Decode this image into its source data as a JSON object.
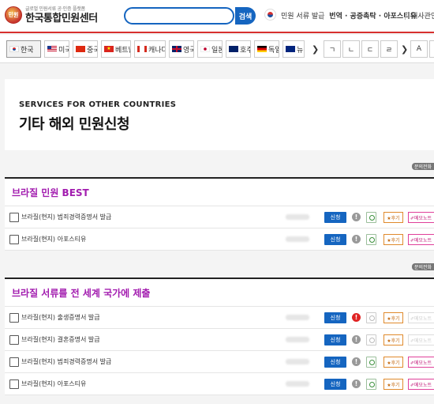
{
  "header": {
    "logo_sub": "글로벌 민원서류 공·인증 플랫폼",
    "logo_main": "한국통합민원센터",
    "logo_seal": "민원",
    "search_placeholder": "",
    "search_button": "검색",
    "nav": [
      "민원 서류 발급",
      "번역 · 공증촉탁 · 아포스티유",
      "대사관인"
    ]
  },
  "country_tabs": [
    "한국",
    "미국",
    "중국",
    "베트남",
    "캐나다",
    "영국",
    "일본",
    "호주",
    "독일",
    "뉴질"
  ],
  "prev_arrow": "❯",
  "next_arrow": "❯",
  "index_tabs": [
    "ㄱ",
    "ㄴ",
    "ㄷ",
    "ㄹ",
    "A",
    "B"
  ],
  "banner": {
    "english": "SERVICES FOR OTHER COUNTRIES",
    "korean": "기타 해외 민원신청"
  },
  "inquiry_label": "문의전화",
  "sections": [
    {
      "title": "브라질 민원 BEST",
      "rows": [
        {
          "name": "브라질(현지) 범죄경력증명서 발급",
          "apply": "신청",
          "review": "★후기",
          "memo": "✐메모노트"
        },
        {
          "name": "브라질(현지) 아포스티유",
          "apply": "신청",
          "review": "★후기",
          "memo": "✐메모노트"
        }
      ]
    },
    {
      "title": "브라질 서류를 전 세계 국가에 제출",
      "rows": [
        {
          "name": "브라질(현지) 출생증명서 발급",
          "apply": "신청",
          "review": "★후기",
          "memo": "✐메모노트"
        },
        {
          "name": "브라질(현지) 결혼증명서 발급",
          "apply": "신청",
          "review": "★후기",
          "memo": "✐메모노트"
        },
        {
          "name": "브라질(현지) 범죄경력증명서 발급",
          "apply": "신청",
          "review": "★후기",
          "memo": "✐메모노트"
        },
        {
          "name": "브라질(현지) 아포스티유",
          "apply": "신청",
          "review": "★후기",
          "memo": "✐메모노트"
        }
      ]
    }
  ],
  "info_glyph": "!",
  "colors": {
    "accent_blue": "#1565c0",
    "section_title": "#a21caf",
    "header_line": "#d7302e"
  }
}
